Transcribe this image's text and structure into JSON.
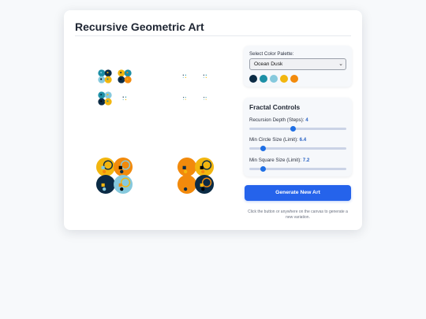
{
  "header": {
    "title": "Recursive Geometric Art"
  },
  "palette": {
    "label": "Select Color Palette:",
    "selected": "Ocean Dusk",
    "colors": [
      "#0b2b45",
      "#1d8fa6",
      "#86c9dd",
      "#f2b60f",
      "#f28a0c"
    ]
  },
  "controls": {
    "title": "Fractal Controls",
    "sliders": [
      {
        "label": "Recursion Depth (Steps):",
        "value": "4",
        "fraction": 0.45
      },
      {
        "label": "Min Circle Size (Limit):",
        "value": "6.4",
        "fraction": 0.14
      },
      {
        "label": "Min Square Size (Limit):",
        "value": "7.2",
        "fraction": 0.14
      }
    ]
  },
  "actions": {
    "generate_label": "Generate New Art",
    "hint": "Click the button or anywhere on the canvas to generate a new variation."
  },
  "icons": {
    "select_arrow": "chevron-down-icon"
  }
}
